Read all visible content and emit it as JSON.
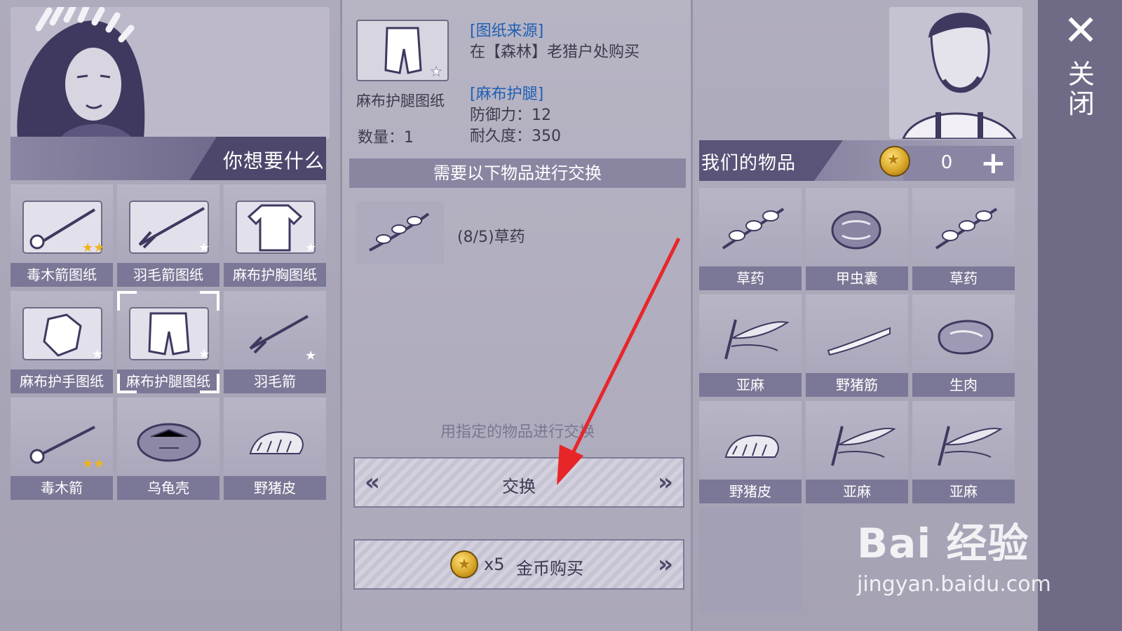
{
  "left": {
    "banner_label": "你想要什么",
    "items": [
      {
        "label": "毒木箭图纸",
        "icon": "poison-arrow-blueprint-icon",
        "stars": 2
      },
      {
        "label": "羽毛箭图纸",
        "icon": "feather-arrow-blueprint-icon",
        "stars": 1
      },
      {
        "label": "麻布护胸图纸",
        "icon": "linen-chest-blueprint-icon",
        "stars": 1
      },
      {
        "label": "麻布护手图纸",
        "icon": "linen-gloves-blueprint-icon",
        "stars": 1
      },
      {
        "label": "麻布护腿图纸",
        "icon": "linen-leggings-blueprint-icon",
        "stars": 1,
        "selected": true
      },
      {
        "label": "羽毛箭",
        "icon": "feather-arrow-icon",
        "stars": 1
      },
      {
        "label": "毒木箭",
        "icon": "poison-arrow-icon",
        "stars": 2
      },
      {
        "label": "乌龟壳",
        "icon": "turtle-shell-icon"
      },
      {
        "label": "野猪皮",
        "icon": "boar-hide-icon"
      }
    ]
  },
  "middle": {
    "item_name": "麻布护腿图纸",
    "quantity": "数量：1",
    "source_title": "[图纸来源]",
    "source_text": "在【森林】老猎户处购买",
    "product_title": "[麻布护腿]",
    "defense": "防御力：12",
    "durability": "耐久度：350",
    "exchange_header": "需要以下物品进行交换",
    "requirement": "(8/5)草药",
    "hint": "用指定的物品进行交换",
    "exchange_button": "交换",
    "buy_count": "x5",
    "buy_label": "金币购买"
  },
  "right": {
    "banner_label": "我们的物品",
    "coins": "0",
    "items": [
      {
        "label": "草药",
        "icon": "herb-icon"
      },
      {
        "label": "甲虫囊",
        "icon": "beetle-sac-icon"
      },
      {
        "label": "草药",
        "icon": "herb-icon"
      },
      {
        "label": "亚麻",
        "icon": "flax-icon"
      },
      {
        "label": "野猪筋",
        "icon": "boar-tendon-icon"
      },
      {
        "label": "生肉",
        "icon": "raw-meat-icon"
      },
      {
        "label": "野猪皮",
        "icon": "boar-hide-icon"
      },
      {
        "label": "亚麻",
        "icon": "flax-icon"
      },
      {
        "label": "亚麻",
        "icon": "flax-icon"
      }
    ]
  },
  "close_label": "关闭",
  "watermark": {
    "brand": "Bai 经验",
    "url": "jingyan.baidu.com"
  },
  "colors": {
    "label_bar": "#7b7796",
    "title_blue": "#1f5fb3",
    "arrow": "#e8262a"
  }
}
